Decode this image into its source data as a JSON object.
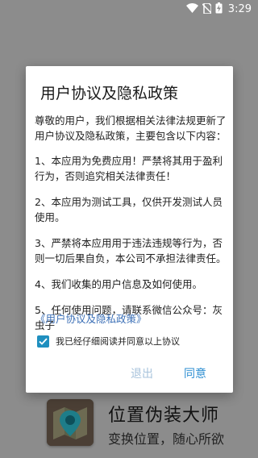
{
  "status_bar": {
    "time": "3:29"
  },
  "app": {
    "title": "位置伪装大师",
    "subtitle": "变换位置，随心所欲"
  },
  "dialog": {
    "title": "用户协议及隐私政策",
    "intro": "尊敬的用户，我们根据相关法律法规更新了用户协议及隐私政策，主要包含以下内容：",
    "items": [
      "1、本应用为免费应用！严禁将其用于盈利行为，否则追究相关法律责任！",
      "2、本应用为测试工具，仅供开发测试人员使用。",
      "3、严禁将本应用用于违法违规等行为，否则一切后果自负，本公司不承担法律责任。",
      "4、我们收集的用户信息及如何使用。",
      "5、任何使用问题，请联系微信公众号：灰虫子"
    ],
    "policy_link": "《用户协议及隐私政策》",
    "agree_checkbox_label": "我已经仔细阅读并同意以上协议",
    "exit_label": "退出",
    "agree_label": "同意"
  },
  "colors": {
    "overlay": "#8a8a8a",
    "accent": "#2f8fd2",
    "link": "#3b6fb6",
    "checkbox": "#1f8fbf"
  }
}
